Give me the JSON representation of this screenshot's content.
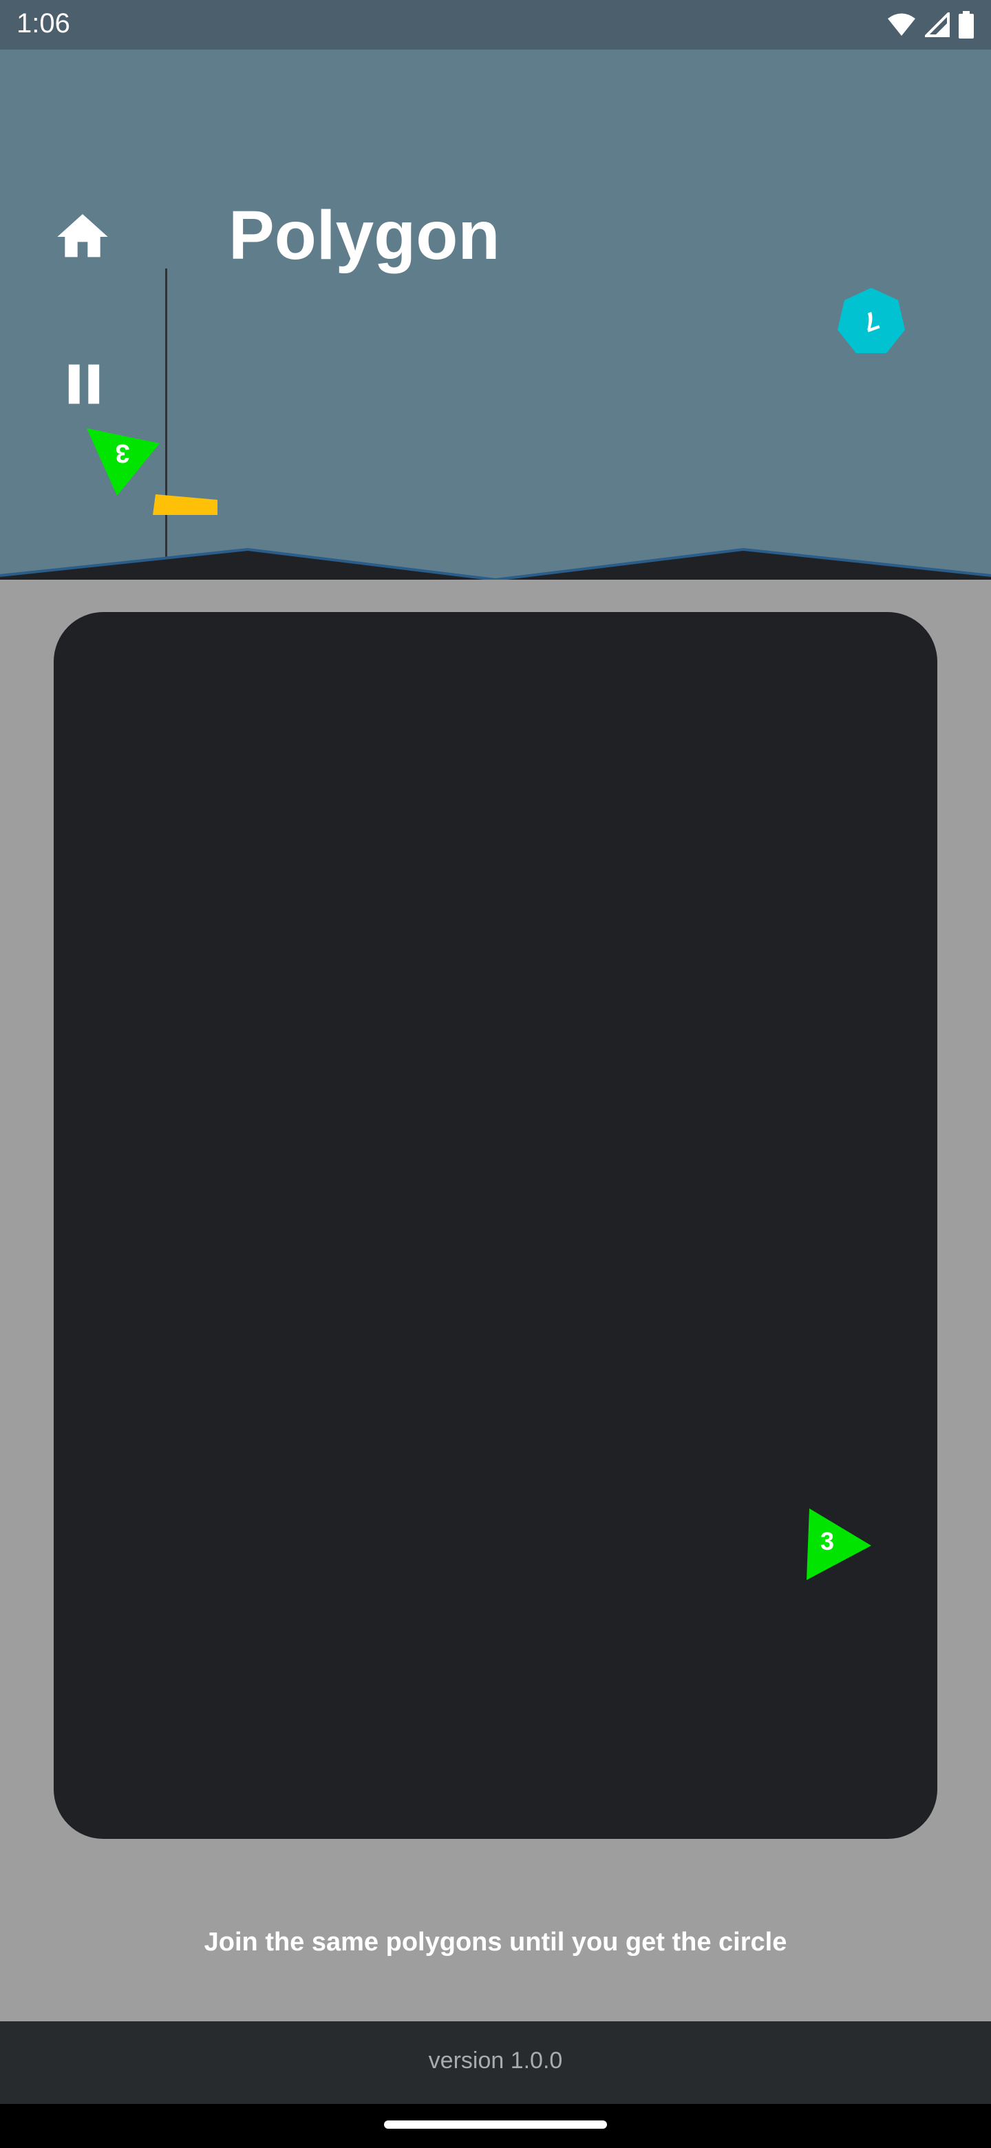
{
  "status_bar": {
    "time": "1:06",
    "icons": [
      "wifi-icon",
      "signal-icon",
      "battery-icon"
    ]
  },
  "header": {
    "title": "Polygon",
    "buttons": [
      "home-icon",
      "pause-icon"
    ]
  },
  "pieces": [
    {
      "shape": "triangle",
      "sides": 3,
      "color": "#00e400",
      "label": "3",
      "area": "header",
      "rotated": true
    },
    {
      "shape": "heptagon",
      "sides": 7,
      "color": "#00c2d1",
      "label": "7",
      "area": "header",
      "rotated": true
    },
    {
      "shape": "triangle",
      "sides": 3,
      "color": "#00e400",
      "label": "3",
      "area": "board"
    }
  ],
  "hint": "Join the same polygons until you get the circle",
  "footer": {
    "version": "version 1.0.0"
  },
  "colors": {
    "header_bg": "#607d8b",
    "status_bg": "#4b5f6c",
    "page_bg": "#9e9e9e",
    "board_bg": "#1f2124",
    "footer_bg": "#282b2e",
    "yellow_block": "#ffc107"
  }
}
